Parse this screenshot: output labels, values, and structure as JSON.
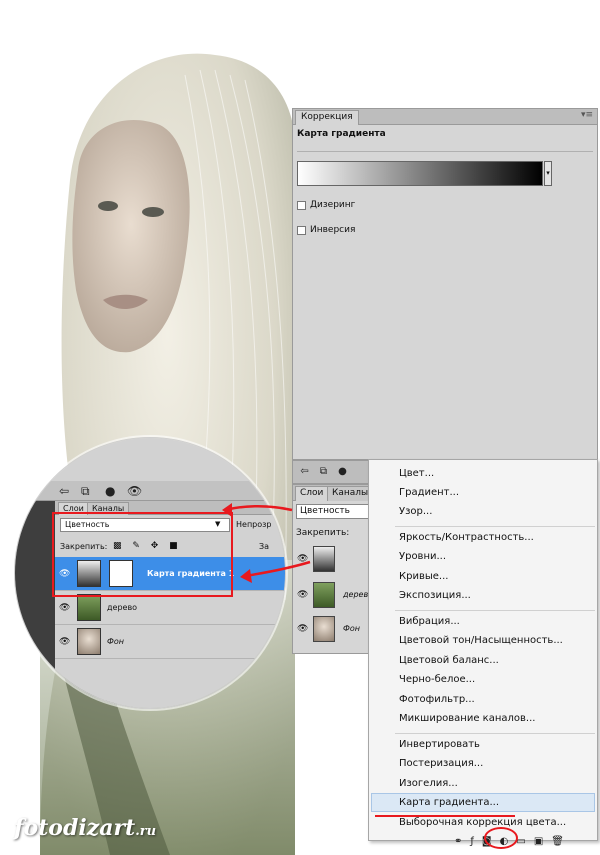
{
  "correction_panel": {
    "tab": "Коррекция",
    "menu_glyph": "▾≡",
    "heading": "Карта градиента",
    "gradient_dropdown_glyph": "▾",
    "checkboxes": [
      "Дизеринг",
      "Инверсия"
    ]
  },
  "layers_panel": {
    "tabs": [
      "Слои",
      "Каналы"
    ],
    "blend_mode": "Цветность",
    "lock_label": "Закрепить:",
    "layers": [
      {
        "name": "Карта градиента 1",
        "thumb": "gradient-map"
      },
      {
        "name": "дерево",
        "thumb": "tree"
      },
      {
        "name": "Фон",
        "thumb": "portrait"
      }
    ]
  },
  "zoom": {
    "tabs": [
      "Слои",
      "Каналы"
    ],
    "blend_mode": "Цветность",
    "opacity_label": "Непрозр",
    "lock_label": "Закрепить:",
    "lock_icons": "▩ ✎ ✥ ■",
    "fill_label": "За",
    "layers": [
      "Карта градиента 1",
      "дерево",
      "Фон"
    ]
  },
  "adjustment_menu": {
    "groups": [
      [
        "Цвет...",
        "Градиент...",
        "Узор..."
      ],
      [
        "Яркость/Контрастность...",
        "Уровни...",
        "Кривые...",
        "Экспозиция..."
      ],
      [
        "Вибрация...",
        "Цветовой тон/Насыщенность...",
        "Цветовой баланс...",
        "Черно-белое...",
        "Фотофильтр...",
        "Микширование каналов..."
      ],
      [
        "Инвертировать",
        "Постеризация...",
        "Изогелия...",
        "Карта градиента...",
        "Выборочная коррекция цвета..."
      ]
    ],
    "highlighted": "Карта градиента..."
  },
  "toolbar_icons": [
    "link-icon",
    "fx-icon",
    "mask-icon",
    "adjustment-icon",
    "folder-icon",
    "new-layer-icon",
    "trash-icon"
  ],
  "logo": {
    "main": "fotodizart",
    "suffix": ".ru"
  },
  "colors": {
    "accent_red": "#e8191e",
    "selection_blue": "#3d8ee8",
    "panel_gray": "#d6d6d6",
    "menu_highlight": "#dbe8f5"
  }
}
